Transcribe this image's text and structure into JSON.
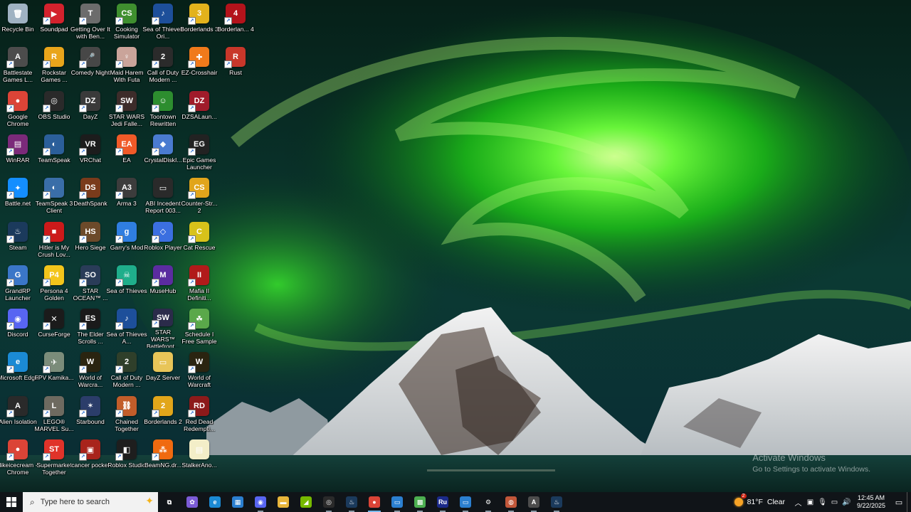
{
  "desktop": {
    "icons": [
      {
        "label": "Recycle Bin",
        "icon": "recycle-bin-icon",
        "color": "#9fb2c2",
        "glyph": "🗑",
        "shortcut": false
      },
      {
        "label": "Soundpad",
        "icon": "soundpad-icon",
        "color": "#d3222d",
        "glyph": "▶",
        "shortcut": true
      },
      {
        "label": "Getting Over It with Ben...",
        "icon": "hammer-icon",
        "color": "#6c6c6c",
        "glyph": "T",
        "shortcut": true
      },
      {
        "label": "Cooking Simulator",
        "icon": "cooking-simulator-icon",
        "color": "#3f8f2f",
        "glyph": "CS",
        "shortcut": true
      },
      {
        "label": "Sea of Thieves Ori...",
        "icon": "music-note-icon",
        "color": "#1d4f9a",
        "glyph": "♪",
        "shortcut": true
      },
      {
        "label": "Borderlands 3",
        "icon": "borderlands-3-icon",
        "color": "#e3b21c",
        "glyph": "3",
        "shortcut": true
      },
      {
        "label": "Borderlan... 4",
        "icon": "borderlands-4-icon",
        "color": "#b3131b",
        "glyph": "4",
        "shortcut": true
      },
      {
        "label": "Battlestate Games L...",
        "icon": "battlestate-icon",
        "color": "#4c4c4c",
        "glyph": "A",
        "shortcut": true
      },
      {
        "label": "Rockstar Games ...",
        "icon": "rockstar-icon",
        "color": "#e9a51b",
        "glyph": "R",
        "shortcut": true
      },
      {
        "label": "Comedy Night",
        "icon": "microphone-icon",
        "color": "#474747",
        "glyph": "🎤",
        "shortcut": true
      },
      {
        "label": "Maid Harem With Futa",
        "icon": "anime-game-icon",
        "color": "#caa49a",
        "glyph": "♀",
        "shortcut": true
      },
      {
        "label": "Call of Duty Modern ...",
        "icon": "call-of-duty-icon",
        "color": "#2b2b2b",
        "glyph": "2",
        "shortcut": true
      },
      {
        "label": "EZ-Crosshair",
        "icon": "crosshair-icon",
        "color": "#f07a1b",
        "glyph": "✚",
        "shortcut": true
      },
      {
        "label": "Rust",
        "icon": "rust-icon",
        "color": "#c8372a",
        "glyph": "R",
        "shortcut": true
      },
      {
        "label": "Google Chrome",
        "icon": "chrome-icon",
        "color": "#db4437",
        "glyph": "●",
        "shortcut": true
      },
      {
        "label": "OBS Studio",
        "icon": "obs-icon",
        "color": "#2a2a2a",
        "glyph": "◎",
        "shortcut": true
      },
      {
        "label": "DayZ",
        "icon": "dayz-icon",
        "color": "#3a3a3a",
        "glyph": "DZ",
        "shortcut": true
      },
      {
        "label": "STAR WARS Jedi Falle...",
        "icon": "star-wars-jedi-icon",
        "color": "#3d2c2a",
        "glyph": "SW",
        "shortcut": true
      },
      {
        "label": "Toontown Rewritten",
        "icon": "toontown-icon",
        "color": "#2d8d2f",
        "glyph": "☺",
        "shortcut": true
      },
      {
        "label": "DZSALaun...",
        "icon": "dzsa-icon",
        "color": "#a01b2a",
        "glyph": "DZ",
        "shortcut": true
      },
      {
        "label": "WinRAR",
        "icon": "winrar-icon",
        "color": "#7b2a7a",
        "glyph": "▤",
        "shortcut": true
      },
      {
        "label": "TeamSpeak",
        "icon": "teamspeak-icon",
        "color": "#2b5f9a",
        "glyph": "◐",
        "shortcut": true
      },
      {
        "label": "VRChat",
        "icon": "vrchat-icon",
        "color": "#1c1c1c",
        "glyph": "VR",
        "shortcut": true
      },
      {
        "label": "EA",
        "icon": "ea-icon",
        "color": "#f05a28",
        "glyph": "EA",
        "shortcut": true
      },
      {
        "label": "CrystalDiskI...",
        "icon": "crystaldisk-icon",
        "color": "#4a7bd0",
        "glyph": "◆",
        "shortcut": true
      },
      {
        "label": "Epic Games Launcher",
        "icon": "epic-games-icon",
        "color": "#222",
        "glyph": "EG",
        "shortcut": true
      },
      {
        "label": "Battle.net",
        "icon": "battle-net-icon",
        "color": "#148eff",
        "glyph": "✦",
        "shortcut": true
      },
      {
        "label": "TeamSpeak 3 Client",
        "icon": "teamspeak-3-icon",
        "color": "#3a6ea8",
        "glyph": "◐",
        "shortcut": true
      },
      {
        "label": "DeathSpank",
        "icon": "deathspank-icon",
        "color": "#7a3b1b",
        "glyph": "DS",
        "shortcut": true
      },
      {
        "label": "Arma 3",
        "icon": "arma-3-icon",
        "color": "#3c3c3c",
        "glyph": "A3",
        "shortcut": true
      },
      {
        "label": "ABI Incedent Report 003...",
        "icon": "video-file-icon",
        "color": "#2a2a2a",
        "glyph": "▭",
        "shortcut": false
      },
      {
        "label": "Counter-Str... 2",
        "icon": "counter-strike-icon",
        "color": "#e1a51b",
        "glyph": "CS",
        "shortcut": true
      },
      {
        "label": "Steam",
        "icon": "steam-icon",
        "color": "#1b3a5c",
        "glyph": "♨",
        "shortcut": true
      },
      {
        "label": "Hitler is My Crush Lov...",
        "icon": "red-game-icon",
        "color": "#cc1a1a",
        "glyph": "■",
        "shortcut": true
      },
      {
        "label": "Hero Siege",
        "icon": "hero-siege-icon",
        "color": "#6c4a2a",
        "glyph": "HS",
        "shortcut": true
      },
      {
        "label": "Garry's Mod",
        "icon": "garrys-mod-icon",
        "color": "#2f7ee0",
        "glyph": "g",
        "shortcut": true
      },
      {
        "label": "Roblox Player",
        "icon": "roblox-icon",
        "color": "#3b6fe0",
        "glyph": "◇",
        "shortcut": true
      },
      {
        "label": "Cat Rescue",
        "icon": "cat-rescue-icon",
        "color": "#d8c21a",
        "glyph": "C",
        "shortcut": true
      },
      {
        "label": "GrandRP Launcher",
        "icon": "grandrp-icon",
        "color": "#3a76c8",
        "glyph": "G",
        "shortcut": true
      },
      {
        "label": "Persona 4 Golden",
        "icon": "persona-4-icon",
        "color": "#f3c51b",
        "glyph": "P4",
        "shortcut": true
      },
      {
        "label": "STAR OCEAN™ ...",
        "icon": "star-ocean-icon",
        "color": "#2a3c58",
        "glyph": "SO",
        "shortcut": true
      },
      {
        "label": "Sea of Thieves",
        "icon": "sea-of-thieves-icon",
        "color": "#1fae8b",
        "glyph": "☠",
        "shortcut": true
      },
      {
        "label": "MuseHub",
        "icon": "musehub-icon",
        "color": "#5b2ca0",
        "glyph": "M",
        "shortcut": true
      },
      {
        "label": "Mafia II Definiti...",
        "icon": "mafia-ii-icon",
        "color": "#b11a1a",
        "glyph": "II",
        "shortcut": true
      },
      {
        "label": "Discord",
        "icon": "discord-icon",
        "color": "#5865f2",
        "glyph": "◉",
        "shortcut": true
      },
      {
        "label": "CurseForge",
        "icon": "curseforge-icon",
        "color": "#1b1b1b",
        "glyph": "✕",
        "shortcut": true
      },
      {
        "label": "The Elder Scrolls ...",
        "icon": "elder-scrolls-icon",
        "color": "#1a1a1a",
        "glyph": "ES",
        "shortcut": true
      },
      {
        "label": "Sea of Thieves A...",
        "icon": "music-note-icon",
        "color": "#1d4f9a",
        "glyph": "♪",
        "shortcut": true
      },
      {
        "label": "STAR WARS™ Battlefront...",
        "icon": "battlefront-icon",
        "color": "#2b2b4a",
        "glyph": "SW",
        "shortcut": true
      },
      {
        "label": "Schedule I Free Sample",
        "icon": "schedule-i-icon",
        "color": "#5aa84a",
        "glyph": "☘",
        "shortcut": true
      },
      {
        "label": "Microsoft Edge",
        "icon": "edge-icon",
        "color": "#1b8ad4",
        "glyph": "e",
        "shortcut": true
      },
      {
        "label": "FPV Kamika...",
        "icon": "drone-icon",
        "color": "#7b8c7a",
        "glyph": "✈",
        "shortcut": true
      },
      {
        "label": "World of Warcra...",
        "icon": "wow-icon",
        "color": "#2a2410",
        "glyph": "W",
        "shortcut": true
      },
      {
        "label": "Call of Duty Modern ...",
        "icon": "call-of-duty-icon",
        "color": "#2f3f2a",
        "glyph": "2",
        "shortcut": true
      },
      {
        "label": "DayZ Server",
        "icon": "folder-icon",
        "color": "#e8c558",
        "glyph": "▭",
        "shortcut": false
      },
      {
        "label": "World of Warcraft",
        "icon": "wow-icon",
        "color": "#2a2410",
        "glyph": "W",
        "shortcut": true
      },
      {
        "label": "Alien Isolation",
        "icon": "alien-isolation-icon",
        "color": "#2a2a2a",
        "glyph": "A",
        "shortcut": true
      },
      {
        "label": "LEGO® MARVEL Su...",
        "icon": "lego-marvel-icon",
        "color": "#6e6a60",
        "glyph": "L",
        "shortcut": true
      },
      {
        "label": "Starbound",
        "icon": "starbound-icon",
        "color": "#2b3d6a",
        "glyph": "✶",
        "shortcut": true
      },
      {
        "label": "Chained Together",
        "icon": "chained-together-icon",
        "color": "#c25d2a",
        "glyph": "⛓",
        "shortcut": true
      },
      {
        "label": "Borderlands 2",
        "icon": "borderlands-2-icon",
        "color": "#e2a61a",
        "glyph": "2",
        "shortcut": true
      },
      {
        "label": "Red Dead Redempti...",
        "icon": "red-dead-icon",
        "color": "#8c1a1a",
        "glyph": "RD",
        "shortcut": true
      },
      {
        "label": "ilikeicecream - Chrome",
        "icon": "chrome-icon",
        "color": "#db4437",
        "glyph": "●",
        "shortcut": true
      },
      {
        "label": "Supermarket Together",
        "icon": "supermarket-icon",
        "color": "#e0332a",
        "glyph": "ST",
        "shortcut": true
      },
      {
        "label": "cancer pocket",
        "icon": "cancer-pocket-icon",
        "color": "#a8241c",
        "glyph": "▣",
        "shortcut": true
      },
      {
        "label": "Roblox Studio",
        "icon": "roblox-studio-icon",
        "color": "#1e1e1e",
        "glyph": "◧",
        "shortcut": true
      },
      {
        "label": "BeamNG.dr...",
        "icon": "beamng-icon",
        "color": "#f06a10",
        "glyph": "⁂",
        "shortcut": true
      },
      {
        "label": "StalkerAno...",
        "icon": "text-file-icon",
        "color": "#f3eec8",
        "glyph": "▤",
        "shortcut": false
      }
    ]
  },
  "watermark": {
    "line1": "Activate Windows",
    "line2": "Go to Settings to activate Windows."
  },
  "taskbar": {
    "search_placeholder": "Type here to search",
    "apps": [
      {
        "name": "task-view-button",
        "glyph": "⧉",
        "color": "transparent",
        "state": ""
      },
      {
        "name": "copilot-button",
        "glyph": "✿",
        "color": "#7b5bd6",
        "state": ""
      },
      {
        "name": "edge-app-button",
        "glyph": "e",
        "color": "#1b8ad4",
        "state": ""
      },
      {
        "name": "store-app-button",
        "glyph": "▦",
        "color": "#2b7fd0",
        "state": ""
      },
      {
        "name": "discord-app-button",
        "glyph": "◉",
        "color": "#5865f2",
        "state": "open"
      },
      {
        "name": "file-explorer-button",
        "glyph": "▬",
        "color": "#e8b53a",
        "state": ""
      },
      {
        "name": "nvidia-app-button",
        "glyph": "◢",
        "color": "#76b900",
        "state": ""
      },
      {
        "name": "obs-app-button",
        "glyph": "◎",
        "color": "#2a2a2a",
        "state": "open"
      },
      {
        "name": "steam-app-button",
        "glyph": "♨",
        "color": "#1b3a5c",
        "state": "open"
      },
      {
        "name": "chrome-app-button",
        "glyph": "●",
        "color": "#db4437",
        "state": "active"
      },
      {
        "name": "window-app-button",
        "glyph": "▭",
        "color": "#2b7fd0",
        "state": "open"
      },
      {
        "name": "minecraft-app-button",
        "glyph": "▩",
        "color": "#4caf50",
        "state": "open"
      },
      {
        "name": "russian-app-button",
        "glyph": "Ru",
        "color": "#1b2a8a",
        "state": "open"
      },
      {
        "name": "window2-app-button",
        "glyph": "▭",
        "color": "#2b7fd0",
        "state": "open"
      },
      {
        "name": "gear-app-button",
        "glyph": "⚙",
        "color": "transparent",
        "state": "open"
      },
      {
        "name": "game-app-button",
        "glyph": "◍",
        "color": "#c2573a",
        "state": "open"
      },
      {
        "name": "battlestate-app-button",
        "glyph": "A",
        "color": "#4c4c4c",
        "state": "open"
      },
      {
        "name": "steam2-app-button",
        "glyph": "♨",
        "color": "#1b3a5c",
        "state": "open"
      }
    ],
    "weather": {
      "temp": "81°F",
      "condition": "Clear"
    },
    "clock": {
      "time": "12:45 AM",
      "date": "9/22/2025"
    }
  }
}
